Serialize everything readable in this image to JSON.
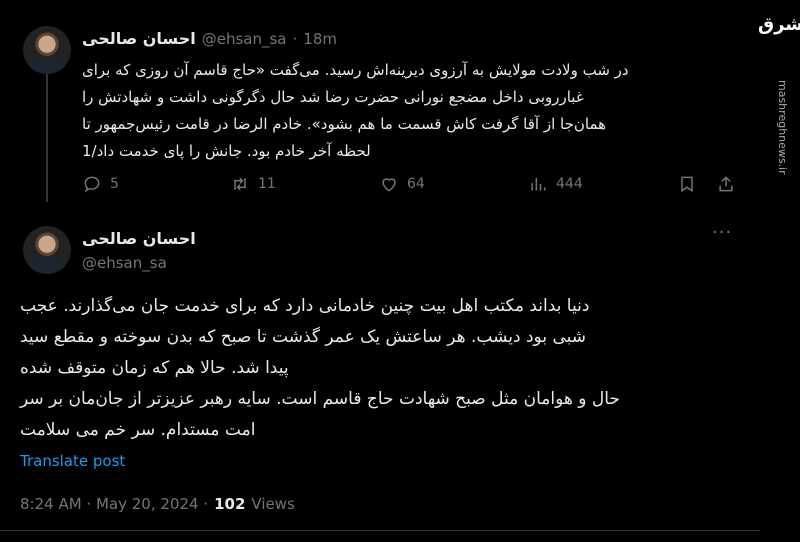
{
  "tweet1": {
    "name": "احسان صالحی",
    "handle": "@ehsan_sa",
    "sep": "·",
    "time": "18m",
    "text_lines": [
      "در شب ولادت مولایش به آرزوی دیرینه‌اش رسید. می‌گفت «حاج قاسم آن روزی که برای",
      "غبارروبی داخل مضجع نورانی حضرت رضا شد حال دگرگونی داشت و شهادتش را",
      "همان‌جا از آقا گرفت کاش قسمت ما هم بشود». خادم الرضا در قامت رئیس‌جمهور تا",
      "لحظه آخر خادم بود. جانش را پای خدمت داد/1"
    ],
    "actions": {
      "replies": "5",
      "reposts": "11",
      "likes": "64",
      "views": "444"
    }
  },
  "tweet2": {
    "name": "احسان صالحی",
    "handle": "@ehsan_sa",
    "text_lines": [
      "دنیا بداند مکتب اهل بیت چنین خادمانی دارد که برای خدمت جان می‌گذارند. عجب",
      "شبی بود دیشب. هر ساعتش یک عمر گذشت تا صبح که بدن سوخته و مقطع سید",
      "پیدا شد. حالا هم که زمان متوقف شده",
      "حال و هوامان مثل صبح شهادت حاج قاسم است. سایه رهبر عزیزتر از جان‌مان بر سر",
      "امت مستدام. سر خم می سلامت"
    ],
    "translate": "Translate post",
    "timestamp": "8:24 AM · May 20, 2024 ·",
    "views_count": "102",
    "views_label": "Views"
  },
  "brand": {
    "logo_text": "مشرق",
    "watermark": "mashreghnews.ir"
  },
  "colors": {
    "background": "#000000",
    "text": "#e7e9ea",
    "muted": "#71767b",
    "link": "#1d9bf0"
  }
}
